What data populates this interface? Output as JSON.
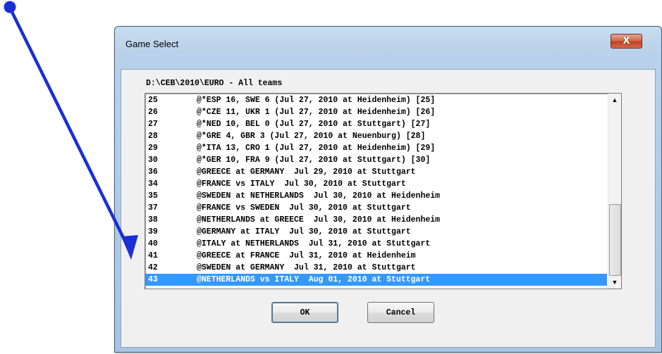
{
  "window": {
    "title": "Game Select",
    "close_label": "X"
  },
  "path_label": "D:\\CEB\\2010\\EURO - All teams",
  "list": {
    "rows": [
      {
        "num": "25",
        "text": "@*ESP 16, SWE 6 (Jul 27, 2010 at Heidenheim) [25]"
      },
      {
        "num": "26",
        "text": "@*CZE 11, UKR 1 (Jul 27, 2010 at Heidenheim) [26]"
      },
      {
        "num": "27",
        "text": "@*NED 10, BEL 0 (Jul 27, 2010 at Stuttgart) [27]"
      },
      {
        "num": "28",
        "text": "@*GRE 4, GBR 3 (Jul 27, 2010 at Neuenburg) [28]"
      },
      {
        "num": "29",
        "text": "@*ITA 13, CRO 1 (Jul 27, 2010 at Heidenheim) [29]"
      },
      {
        "num": "30",
        "text": "@*GER 10, FRA 9 (Jul 27, 2010 at Stuttgart) [30]"
      },
      {
        "num": "36",
        "text": "@GREECE at GERMANY  Jul 29, 2010 at Stuttgart"
      },
      {
        "num": "34",
        "text": "@FRANCE vs ITALY  Jul 30, 2010 at Stuttgart"
      },
      {
        "num": "35",
        "text": "@SWEDEN at NETHERLANDS  Jul 30, 2010 at Heidenheim"
      },
      {
        "num": "37",
        "text": "@FRANCE vs SWEDEN  Jul 30, 2010 at Stuttgart"
      },
      {
        "num": "38",
        "text": "@NETHERLANDS at GREECE  Jul 30, 2010 at Heidenheim"
      },
      {
        "num": "39",
        "text": "@GERMANY at ITALY  Jul 30, 2010 at Stuttgart"
      },
      {
        "num": "40",
        "text": "@ITALY at NETHERLANDS  Jul 31, 2010 at Stuttgart"
      },
      {
        "num": "41",
        "text": "@GREECE at FRANCE  Jul 31, 2010 at Heidenheim"
      },
      {
        "num": "42",
        "text": "@SWEDEN at GERMANY  Jul 31, 2010 at Stuttgart"
      },
      {
        "num": "43",
        "text": "@NETHERLANDS vs ITALY  Aug 01, 2010 at Stuttgart",
        "selected": true
      }
    ],
    "scroll_up_icon": "▲",
    "scroll_down_icon": "▼"
  },
  "buttons": {
    "ok_label": "OK",
    "cancel_label": "Cancel"
  },
  "colors": {
    "selection": "#3399ff",
    "arrow": "#1a2fd6"
  }
}
